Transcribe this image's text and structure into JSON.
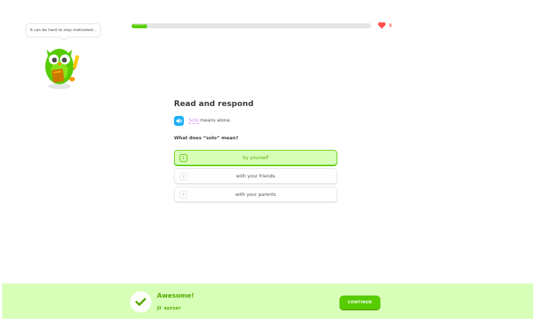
{
  "mascot": {
    "speech": "It can be hard to stay motivated...",
    "icon": "owl-mascot-icon"
  },
  "progress": {
    "fraction": 0.065,
    "color": "#58cc02"
  },
  "hearts": {
    "count": "5",
    "icon": "heart-icon",
    "color": "#ff4b4b"
  },
  "challenge": {
    "title": "Read and respond",
    "passage_word": "Solo",
    "passage_rest": " means alone.",
    "question": "What does “solo” mean?",
    "speaker_icon": "speaker-icon"
  },
  "choices": [
    {
      "number": "1",
      "label": "by yourself",
      "selected": true
    },
    {
      "number": "2",
      "label": "with your friends",
      "selected": false
    },
    {
      "number": "3",
      "label": "with your parents",
      "selected": false
    }
  ],
  "feedback": {
    "title": "Awesome!",
    "report_label": "REPORT",
    "continue_label": "CONTINUE",
    "check_icon": "checkmark-icon",
    "flag_icon": "flag-icon",
    "background": "#d7ffb8",
    "accent": "#58a700"
  }
}
